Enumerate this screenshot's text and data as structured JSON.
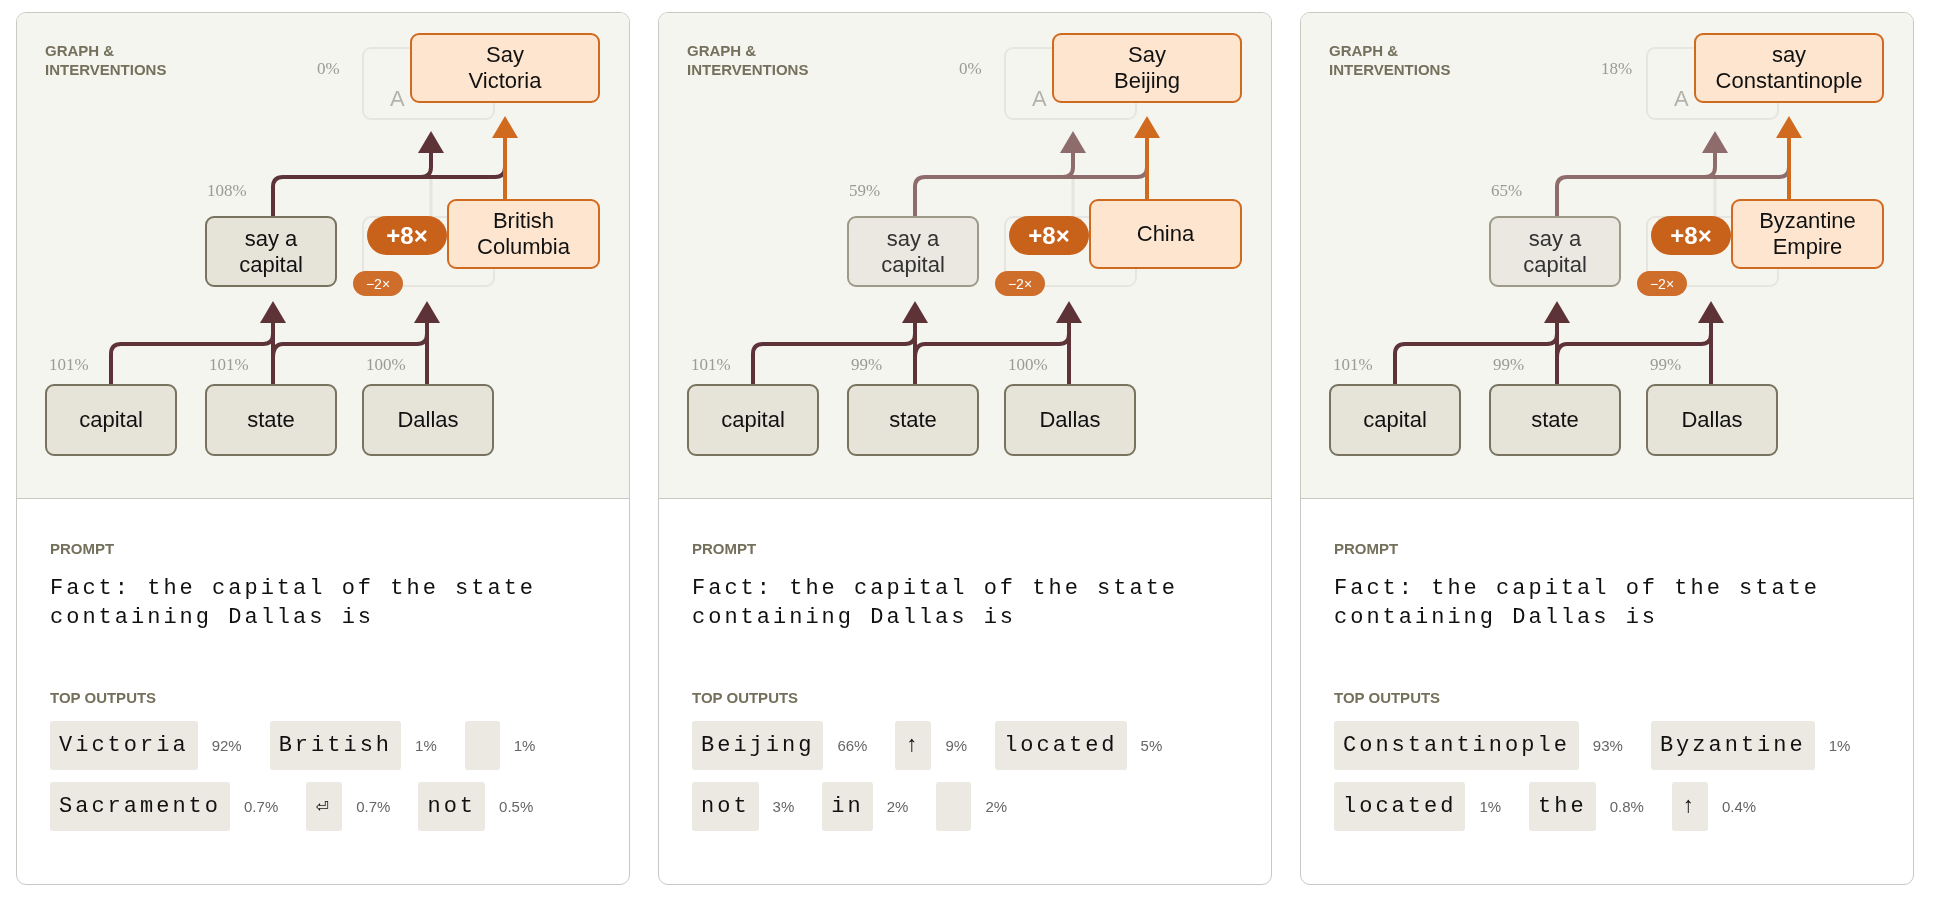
{
  "cards": [
    {
      "graph": {
        "title": "GRAPH &\nINTERVENTIONS",
        "ghost_top": {
          "label": "A",
          "percent": "0%"
        },
        "output": {
          "label": "Say\nVictoria"
        },
        "feature": {
          "label": "say a\ncapital",
          "percent": "108%",
          "dimmed": false
        },
        "intervention": {
          "label": "British\nColumbia",
          "boost": "+8×"
        },
        "suppression": {
          "badge": "−2×"
        },
        "tokens": [
          {
            "label": "capital",
            "percent": "101%"
          },
          {
            "label": "state",
            "percent": "101%"
          },
          {
            "label": "Dallas",
            "percent": "100%"
          }
        ]
      },
      "prompt": {
        "title": "PROMPT",
        "text": "Fact: the capital of the state containing Dallas is"
      },
      "top_outputs": {
        "title": "TOP OUTPUTS",
        "items": [
          {
            "kind": "token",
            "label": "Victoria",
            "percent": "92%"
          },
          {
            "kind": "token",
            "label": "British",
            "percent": "1%"
          },
          {
            "kind": "blank",
            "percent": "1%"
          },
          {
            "kind": "token",
            "label": "Sacramento",
            "percent": "0.7%"
          },
          {
            "kind": "token",
            "label": "⏎",
            "percent": "0.7%"
          },
          {
            "kind": "token",
            "label": "not",
            "percent": "0.5%"
          }
        ]
      }
    },
    {
      "graph": {
        "title": "GRAPH &\nINTERVENTIONS",
        "ghost_top": {
          "label": "A",
          "percent": "0%"
        },
        "output": {
          "label": "Say\nBeijing"
        },
        "feature": {
          "label": "say a\ncapital",
          "percent": "59%",
          "dimmed": true
        },
        "intervention": {
          "label": "China",
          "boost": "+8×"
        },
        "suppression": {
          "badge": "−2×"
        },
        "tokens": [
          {
            "label": "capital",
            "percent": "101%"
          },
          {
            "label": "state",
            "percent": "99%"
          },
          {
            "label": "Dallas",
            "percent": "100%"
          }
        ]
      },
      "prompt": {
        "title": "PROMPT",
        "text": "Fact: the capital of the state containing Dallas is"
      },
      "top_outputs": {
        "title": "TOP OUTPUTS",
        "items": [
          {
            "kind": "token",
            "label": "Beijing",
            "percent": "66%"
          },
          {
            "kind": "token",
            "label": "↑",
            "percent": "9%"
          },
          {
            "kind": "token",
            "label": "located",
            "percent": "5%"
          },
          {
            "kind": "token",
            "label": "not",
            "percent": "3%"
          },
          {
            "kind": "token",
            "label": "in",
            "percent": "2%"
          },
          {
            "kind": "blank",
            "percent": "2%"
          }
        ]
      }
    },
    {
      "graph": {
        "title": "GRAPH &\nINTERVENTIONS",
        "ghost_top": {
          "label": "A",
          "percent": "18%"
        },
        "output": {
          "label": "say\nConstantinople"
        },
        "feature": {
          "label": "say a\ncapital",
          "percent": "65%",
          "dimmed": true
        },
        "intervention": {
          "label": "Byzantine\nEmpire",
          "boost": "+8×"
        },
        "suppression": {
          "badge": "−2×"
        },
        "tokens": [
          {
            "label": "capital",
            "percent": "101%"
          },
          {
            "label": "state",
            "percent": "99%"
          },
          {
            "label": "Dallas",
            "percent": "99%"
          }
        ]
      },
      "prompt": {
        "title": "PROMPT",
        "text": "Fact: the capital of the state containing Dallas is"
      },
      "top_outputs": {
        "title": "TOP OUTPUTS",
        "items": [
          {
            "kind": "token",
            "label": "Constantinople",
            "percent": "93%"
          },
          {
            "kind": "token",
            "label": "Byzantine",
            "percent": "1%"
          },
          {
            "kind": "token",
            "label": "located",
            "percent": "1%"
          },
          {
            "kind": "token",
            "label": "the",
            "percent": "0.8%"
          },
          {
            "kind": "token",
            "label": "↑",
            "percent": "0.4%"
          }
        ]
      }
    }
  ]
}
